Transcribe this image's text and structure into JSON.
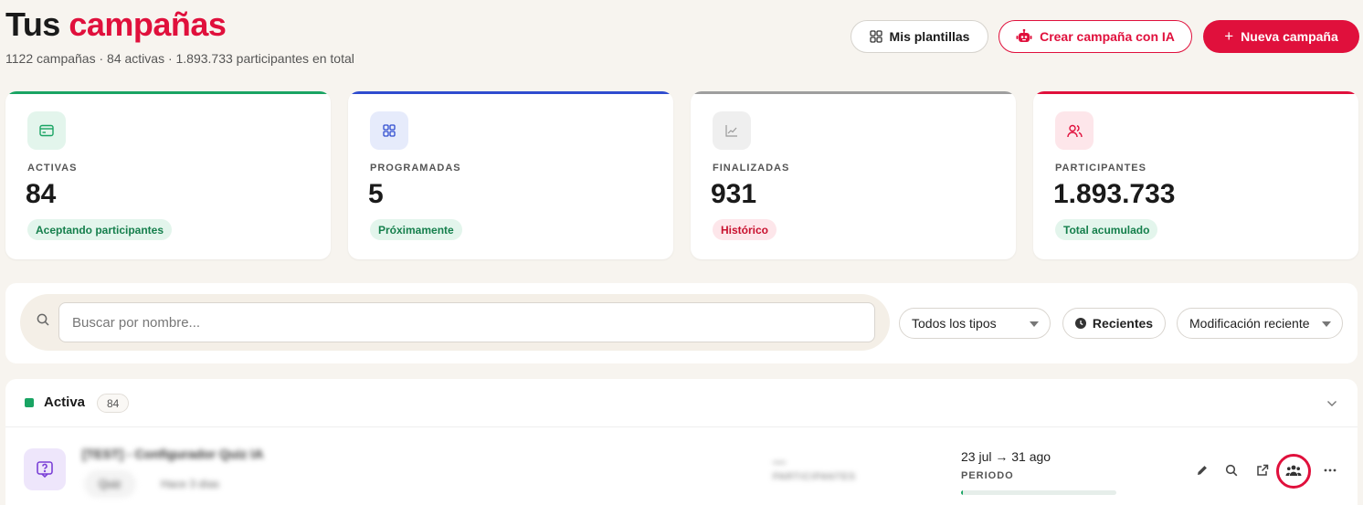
{
  "header": {
    "title_prefix": "Tus",
    "title_accent": "campañas",
    "subtitle": "1122 campañas · 84 activas · 1.893.733 participantes en total",
    "btn_templates": "Mis plantillas",
    "btn_ai": "Crear campaña con IA",
    "btn_new": "Nueva campaña",
    "btn_new_prefix": "+"
  },
  "stats": [
    {
      "label": "ACTIVAS",
      "value": "84",
      "pill": "Aceptando participantes",
      "icon": "card-icon",
      "accent": "#19a463"
    },
    {
      "label": "PROGRAMADAS",
      "value": "5",
      "pill": "Próximamente",
      "icon": "grid-icon",
      "accent": "#2f4ccf"
    },
    {
      "label": "FINALIZADAS",
      "value": "931",
      "pill": "Histórico",
      "icon": "chart-icon",
      "accent": "#9e9e9e"
    },
    {
      "label": "PARTICIPANTES",
      "value": "1.893.733",
      "pill": "Total acumulado",
      "icon": "users-icon",
      "accent": "#e0103c"
    }
  ],
  "filters": {
    "search_placeholder": "Buscar por nombre...",
    "type_select": "Todos los tipos",
    "recent_button": "Recientes",
    "sort_select": "Modificación reciente"
  },
  "group": {
    "name": "Activa",
    "count": "84",
    "color": "#19a463"
  },
  "campaign": {
    "name": "[TEST] - Configurador Quiz IA",
    "type": "Quiz",
    "meta": "Hace 3 días",
    "participants": "—",
    "participants_label": "PARTICIPANTES",
    "period": "23 jul → 31 ago",
    "period_label": "PERIODO",
    "progress": 0.01
  },
  "colors": {
    "brand": "#e0103c",
    "background": "#f7f4ef"
  }
}
